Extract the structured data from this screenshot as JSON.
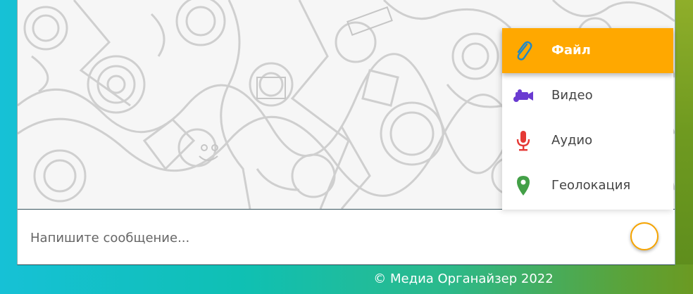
{
  "composer": {
    "placeholder": "Напишите сообщение..."
  },
  "attach_menu": {
    "items": [
      {
        "label": "Файл",
        "icon": "paperclip-icon",
        "active": true
      },
      {
        "label": "Видео",
        "icon": "video-camera-icon",
        "active": false
      },
      {
        "label": "Аудио",
        "icon": "microphone-icon",
        "active": false
      },
      {
        "label": "Геолокация",
        "icon": "location-pin-icon",
        "active": false
      }
    ]
  },
  "footer": {
    "text": "© Медиа Органайзер 2022"
  },
  "colors": {
    "accent": "#ffa800",
    "video_icon": "#6a3bd1",
    "audio_icon": "#e53935",
    "location_icon": "#43a047",
    "file_icon": "#1e88c8"
  }
}
